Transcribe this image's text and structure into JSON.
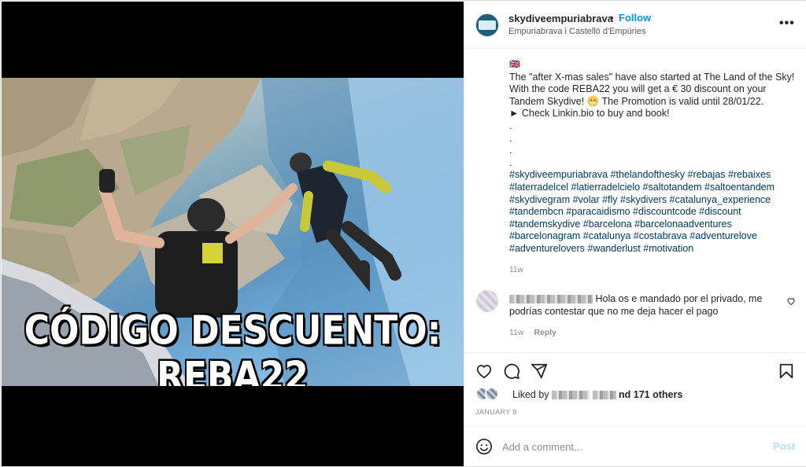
{
  "post": {
    "username": "skydiveempuriabrava",
    "dot": "•",
    "follow_label": "Follow",
    "location": "Empuriabrava i Castelló d'Empúries",
    "more_label": "•••",
    "image_text": "CÓDIGO DESCUENTO: REBA22"
  },
  "caption": {
    "flag": "🇬🇧",
    "line1": "The \"after X-mas sales\" have also started at The Land of the Sky! With the code REBA22 you will get a € 30 discount on your Tandem Skydive! 😁 The Promotion is valid until 28/01/22.",
    "line2": "► Check Linkin.bio to buy and book!",
    "dots": [
      ".",
      ".",
      ".",
      "."
    ],
    "hashtags": "#skydiveempuriabrava #thelandofthesky #rebajas #rebaixes #laterradelcel #latierradelcielo #saltotandem #saltoentandem #skydivegram #volar #fly #skydivers #catalunya_experience #tandembcn #paracaidismo #discountcode #discount #tandemskydive #barcelona #barcelonaadventures #barcelonagram #catalunya #costabrava #adventurelove #adventurelovers #wanderlust #motivation",
    "time": "11w"
  },
  "comment": {
    "text_line1": "Hola os e mandado por el privado, me",
    "text_line2": "podrías contestar que no me deja hacer el pago",
    "time": "11w",
    "reply_label": "Reply"
  },
  "likes": {
    "liked_by": "Liked by",
    "and_others": "nd 171 others",
    "date": "JANUARY 8"
  },
  "add_comment": {
    "placeholder": "Add a comment...",
    "post_label": "Post"
  },
  "colors": {
    "link_blue": "#0095f6",
    "hashtag": "#00376b",
    "post_disabled": "#b2dffc"
  },
  "icons": [
    "heart-icon",
    "comment-icon",
    "share-icon",
    "bookmark-icon",
    "emoji-icon",
    "more-icon"
  ]
}
